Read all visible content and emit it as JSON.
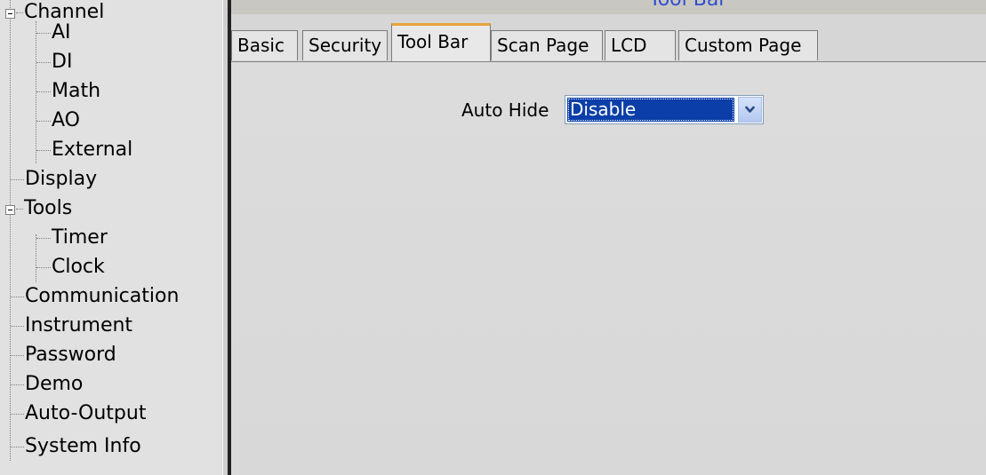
{
  "title": "Tool Bar",
  "tree": {
    "items": [
      {
        "label": "Channel",
        "expanded": true
      },
      {
        "label": "AI"
      },
      {
        "label": "DI"
      },
      {
        "label": "Math"
      },
      {
        "label": "AO"
      },
      {
        "label": "External"
      },
      {
        "label": "Display"
      },
      {
        "label": "Tools",
        "expanded": true
      },
      {
        "label": "Timer"
      },
      {
        "label": "Clock"
      },
      {
        "label": "Communication"
      },
      {
        "label": "Instrument"
      },
      {
        "label": "Password"
      },
      {
        "label": "Demo"
      },
      {
        "label": "Auto-Output"
      },
      {
        "label": "System Info"
      }
    ]
  },
  "tabs": [
    {
      "label": "Basic"
    },
    {
      "label": "Security"
    },
    {
      "label": "Tool Bar",
      "active": true
    },
    {
      "label": "Scan Page"
    },
    {
      "label": "LCD"
    },
    {
      "label": "Custom Page"
    }
  ],
  "form": {
    "auto_hide_label": "Auto Hide",
    "auto_hide_value": "Disable"
  },
  "colors": {
    "selection": "#0b3ea8",
    "active_tab_accent": "#e8a33c",
    "title_text": "#2f4fcf"
  }
}
